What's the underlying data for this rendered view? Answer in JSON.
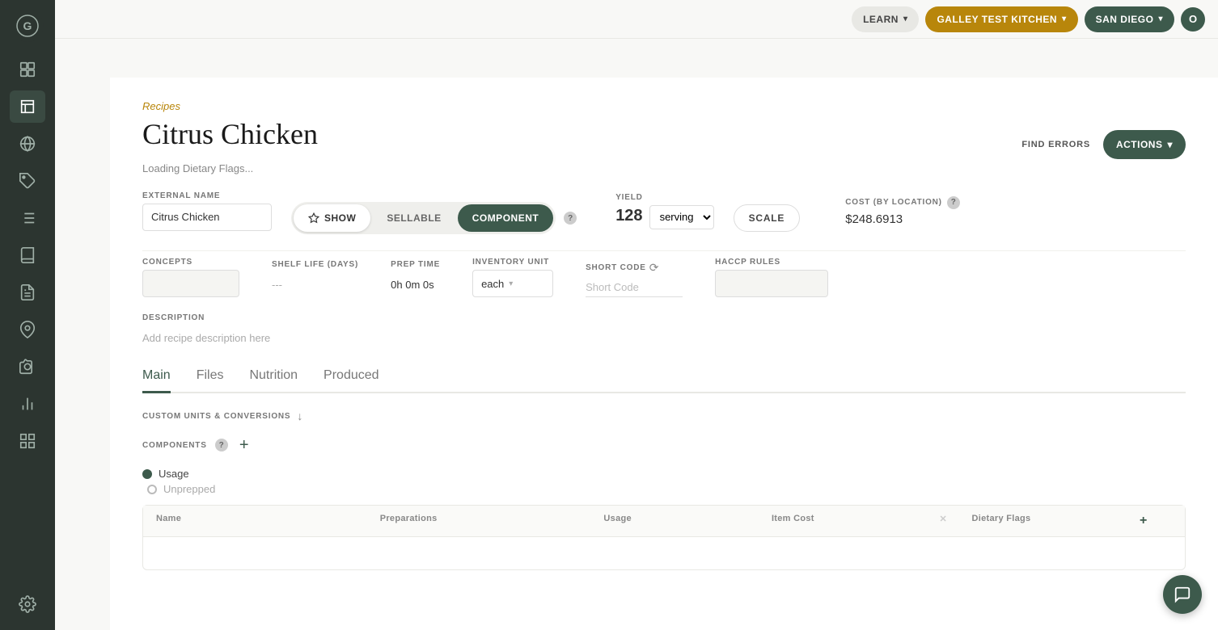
{
  "app": {
    "title": "Galley",
    "logo_icon": "G"
  },
  "topnav": {
    "learn_label": "LEARN",
    "kitchen_label": "GALLEY TEST KITCHEN",
    "location_label": "SAN DIEGO",
    "user_initial": "O"
  },
  "breadcrumb": "Recipes",
  "page_title": "Citrus Chicken",
  "loading_status": "Loading Dietary Flags...",
  "external_name_label": "EXTERNAL NAME",
  "external_name_value": "Citrus Chicken",
  "toggle": {
    "show_label": "SHOW",
    "sellable_label": "SELLABLE",
    "component_label": "COMPONENT"
  },
  "yield_label": "YIELD",
  "yield_value": "128",
  "yield_unit": "serving",
  "scale_label": "SCALE",
  "cost_label": "COST (BY LOCATION)",
  "cost_value": "$248.6913",
  "fields": {
    "concepts_label": "CONCEPTS",
    "shelf_life_label": "SHELF LIFE (DAYS)",
    "shelf_life_value": "---",
    "prep_time_label": "PREP TIME",
    "prep_time_value": "0h  0m  0s",
    "inventory_unit_label": "INVENTORY UNIT",
    "inventory_unit_value": "each",
    "short_code_label": "SHORT CODE",
    "short_code_placeholder": "Short Code",
    "haccp_label": "HACCP RULES"
  },
  "description_label": "DESCRIPTION",
  "description_placeholder": "Add recipe description here",
  "tabs": [
    {
      "label": "Main",
      "active": true
    },
    {
      "label": "Files",
      "active": false
    },
    {
      "label": "Nutrition",
      "active": false
    },
    {
      "label": "Produced",
      "active": false
    }
  ],
  "custom_units_label": "CUSTOM UNITS & CONVERSIONS",
  "components": {
    "title": "COMPONENTS",
    "usage_label": "Usage",
    "unprepped_label": "Unprepped",
    "columns": [
      "Name",
      "Preparations",
      "Usage",
      "Item Cost",
      "",
      "Dietary Flags",
      ""
    ]
  },
  "actions_label": "ACTIONS",
  "find_errors_label": "FIND ERRORS",
  "sidebar_items": [
    {
      "name": "menu-icon",
      "active": false
    },
    {
      "name": "book-icon",
      "active": true
    },
    {
      "name": "globe-icon",
      "active": false
    },
    {
      "name": "tag-icon",
      "active": false
    },
    {
      "name": "list-icon",
      "active": false
    },
    {
      "name": "book2-icon",
      "active": false
    },
    {
      "name": "doc-icon",
      "active": false
    },
    {
      "name": "location-icon",
      "active": false
    },
    {
      "name": "camera-icon",
      "active": false
    },
    {
      "name": "chart-icon",
      "active": false
    },
    {
      "name": "grid-icon",
      "active": false
    },
    {
      "name": "settings-icon",
      "active": false
    }
  ]
}
